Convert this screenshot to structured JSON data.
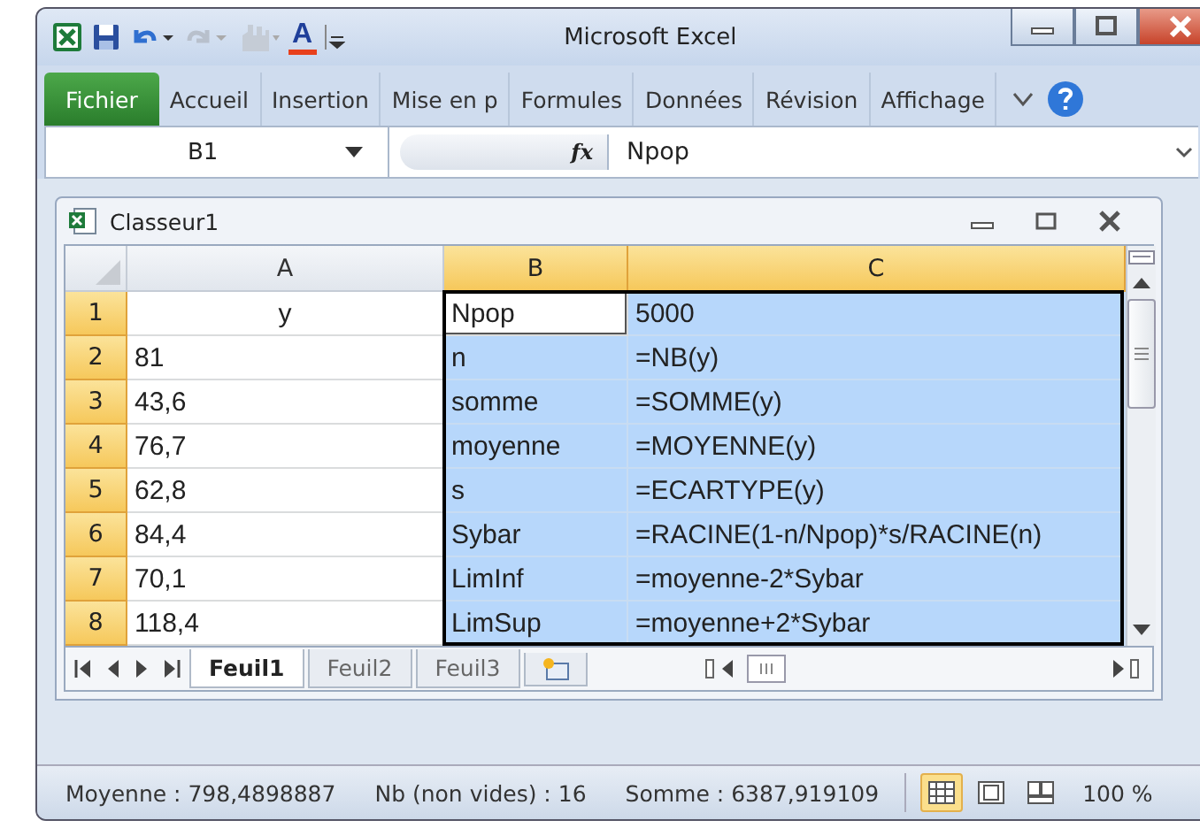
{
  "window": {
    "title": "Microsoft Excel"
  },
  "quick_access": {
    "font_color_glyph": "A"
  },
  "ribbon_tabs": [
    {
      "label": "Fichier",
      "selected": true
    },
    {
      "label": "Accueil",
      "selected": false
    },
    {
      "label": "Insertion",
      "selected": false
    },
    {
      "label": "Mise en p",
      "selected": false
    },
    {
      "label": "Formules",
      "selected": false
    },
    {
      "label": "Données",
      "selected": false
    },
    {
      "label": "Révision",
      "selected": false
    },
    {
      "label": "Affichage",
      "selected": false
    }
  ],
  "formula_bar": {
    "name_box": "B1",
    "fx": "fx",
    "value": "Npop"
  },
  "workbook": {
    "title": "Classeur1"
  },
  "columns": [
    {
      "label": "A",
      "selected": false
    },
    {
      "label": "B",
      "selected": true
    },
    {
      "label": "C",
      "selected": true
    }
  ],
  "rows": [
    {
      "number": "1",
      "selected": true,
      "cells": [
        {
          "text": "y",
          "selected": false,
          "active": false,
          "centered": true
        },
        {
          "text": "Npop",
          "selected": true,
          "active": true
        },
        {
          "text": "5000",
          "selected": true,
          "active": false
        }
      ]
    },
    {
      "number": "2",
      "selected": true,
      "cells": [
        {
          "text": "81",
          "selected": false,
          "active": false
        },
        {
          "text": "n",
          "selected": true,
          "active": false
        },
        {
          "text": "=NB(y)",
          "selected": true,
          "active": false
        }
      ]
    },
    {
      "number": "3",
      "selected": true,
      "cells": [
        {
          "text": "43,6",
          "selected": false,
          "active": false
        },
        {
          "text": "somme",
          "selected": true,
          "active": false
        },
        {
          "text": "=SOMME(y)",
          "selected": true,
          "active": false
        }
      ]
    },
    {
      "number": "4",
      "selected": true,
      "cells": [
        {
          "text": "76,7",
          "selected": false,
          "active": false
        },
        {
          "text": "moyenne",
          "selected": true,
          "active": false
        },
        {
          "text": "=MOYENNE(y)",
          "selected": true,
          "active": false
        }
      ]
    },
    {
      "number": "5",
      "selected": true,
      "cells": [
        {
          "text": "62,8",
          "selected": false,
          "active": false
        },
        {
          "text": "s",
          "selected": true,
          "active": false
        },
        {
          "text": "=ECARTYPE(y)",
          "selected": true,
          "active": false
        }
      ]
    },
    {
      "number": "6",
      "selected": true,
      "cells": [
        {
          "text": "84,4",
          "selected": false,
          "active": false
        },
        {
          "text": "Sybar",
          "selected": true,
          "active": false
        },
        {
          "text": "=RACINE(1-n/Npop)*s/RACINE(n)",
          "selected": true,
          "active": false
        }
      ]
    },
    {
      "number": "7",
      "selected": true,
      "cells": [
        {
          "text": "70,1",
          "selected": false,
          "active": false
        },
        {
          "text": "LimInf",
          "selected": true,
          "active": false
        },
        {
          "text": "=moyenne-2*Sybar",
          "selected": true,
          "active": false
        }
      ]
    },
    {
      "number": "8",
      "selected": true,
      "cells": [
        {
          "text": "118,4",
          "selected": false,
          "active": false
        },
        {
          "text": "LimSup",
          "selected": true,
          "active": false
        },
        {
          "text": "=moyenne+2*Sybar",
          "selected": true,
          "active": false
        }
      ]
    }
  ],
  "sheet_tabs": [
    {
      "label": "Feuil1",
      "selected": true
    },
    {
      "label": "Feuil2",
      "selected": false
    },
    {
      "label": "Feuil3",
      "selected": false
    }
  ],
  "status_bar": {
    "average": "Moyenne : 798,4898887",
    "count": "Nb (non vides) : 16",
    "sum": "Somme : 6387,919109",
    "views": [
      {
        "kind": "normal",
        "selected": true
      },
      {
        "kind": "layout",
        "selected": false
      },
      {
        "kind": "pagebreak",
        "selected": false
      }
    ],
    "zoom": "100 %"
  }
}
